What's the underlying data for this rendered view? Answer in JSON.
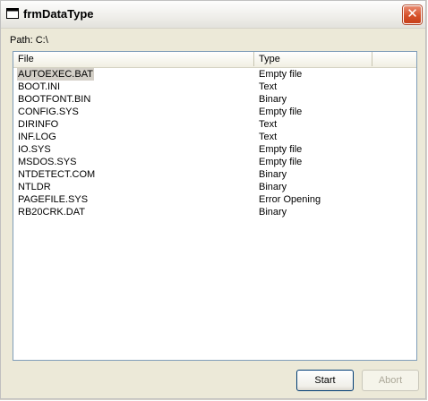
{
  "window": {
    "title": "frmDataType"
  },
  "path_label": "Path: C:\\",
  "list": {
    "columns": [
      "File",
      "Type"
    ],
    "rows": [
      {
        "file": "AUTOEXEC.BAT",
        "type": "Empty file"
      },
      {
        "file": "BOOT.INI",
        "type": "Text"
      },
      {
        "file": "BOOTFONT.BIN",
        "type": "Binary"
      },
      {
        "file": "CONFIG.SYS",
        "type": "Empty file"
      },
      {
        "file": "DIRINFO",
        "type": "Text"
      },
      {
        "file": "INF.LOG",
        "type": "Text"
      },
      {
        "file": "IO.SYS",
        "type": "Empty file"
      },
      {
        "file": "MSDOS.SYS",
        "type": "Empty file"
      },
      {
        "file": "NTDETECT.COM",
        "type": "Binary"
      },
      {
        "file": "NTLDR",
        "type": "Binary"
      },
      {
        "file": "PAGEFILE.SYS",
        "type": "Error Opening"
      },
      {
        "file": "RB20CRK.DAT",
        "type": "Binary"
      }
    ],
    "selected_index": 0
  },
  "buttons": {
    "start_label": "Start",
    "abort_label": "Abort"
  },
  "colors": {
    "close_button": "#d6512a",
    "selection": "#d4d0c8"
  }
}
